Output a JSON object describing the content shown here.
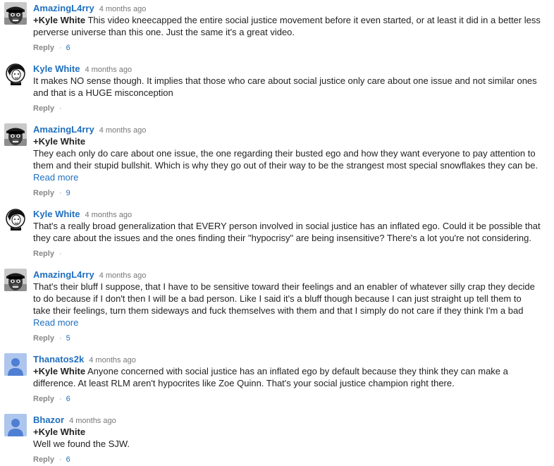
{
  "comments": [
    {
      "author": "AmazingL4rry",
      "time": "4 months ago",
      "avatar": "gorilla-avatar-icon",
      "mention": "+Kyle White",
      "lines": [
        "This video kneecapped the entire social justice movement before it even started, or at least it did in a better less",
        "perverse universe than this one. Just the same it's a great video."
      ],
      "read_more": "",
      "reply": "Reply",
      "likes": "6"
    },
    {
      "author": "Kyle White",
      "time": "4 months ago",
      "avatar": "portrait-avatar-icon",
      "mention": "",
      "lines": [
        "It makes NO sense though. It implies that those who care about social justice only care about one issue and not similar ones",
        "and that is a HUGE misconception"
      ],
      "read_more": "",
      "reply": "Reply",
      "likes": ""
    },
    {
      "author": "AmazingL4rry",
      "time": "4 months ago",
      "avatar": "gorilla-avatar-icon",
      "mention": "+Kyle White",
      "lines": [
        "They each only do care about one issue, the one regarding their busted ego and how they want everyone to pay attention to",
        "them and their stupid bullshit. Which is why they go out of their way to be the strangest most special snowflakes they can be."
      ],
      "read_more": "Read more",
      "reply": "Reply",
      "likes": "9"
    },
    {
      "author": "Kyle White",
      "time": "4 months ago",
      "avatar": "portrait-avatar-icon",
      "mention": "",
      "lines": [
        "That's a really broad generalization that EVERY person involved in social justice has an inflated ego. Could it be possible that",
        "they care about the issues and the ones finding their \"hypocrisy\" are being insensitive? There's a lot you're not considering."
      ],
      "read_more": "",
      "reply": "Reply",
      "likes": ""
    },
    {
      "author": "AmazingL4rry",
      "time": "4 months ago",
      "avatar": "gorilla-avatar-icon",
      "mention": "",
      "lines": [
        "That's their bluff I suppose, that I have to be sensitive toward their feelings and an enabler of whatever silly crap they decide",
        "to do  because if I don't then I will be a bad person. Like I said it's a bluff though because I can just straight up tell them to",
        "take their feelings, turn them sideways and fuck themselves with them and that I simply do not care if they think I'm a bad"
      ],
      "read_more": "Read more",
      "reply": "Reply",
      "likes": "5"
    },
    {
      "author": "Thanatos2k",
      "time": "4 months ago",
      "avatar": "default-user-avatar-icon",
      "mention": "+Kyle White",
      "lines": [
        "Anyone concerned with social justice has an inflated ego by default because they think they can make a",
        "difference.  At least RLM aren't hypocrites like Zoe Quinn.  That's your social justice champion right there."
      ],
      "read_more": "",
      "reply": "Reply",
      "likes": "6"
    },
    {
      "author": "Bhazor",
      "time": "4 months ago",
      "avatar": "default-user-avatar-icon",
      "mention": "+Kyle White",
      "lines": [
        "Well we found the SJW."
      ],
      "read_more": "",
      "reply": "Reply",
      "likes": "6"
    }
  ]
}
